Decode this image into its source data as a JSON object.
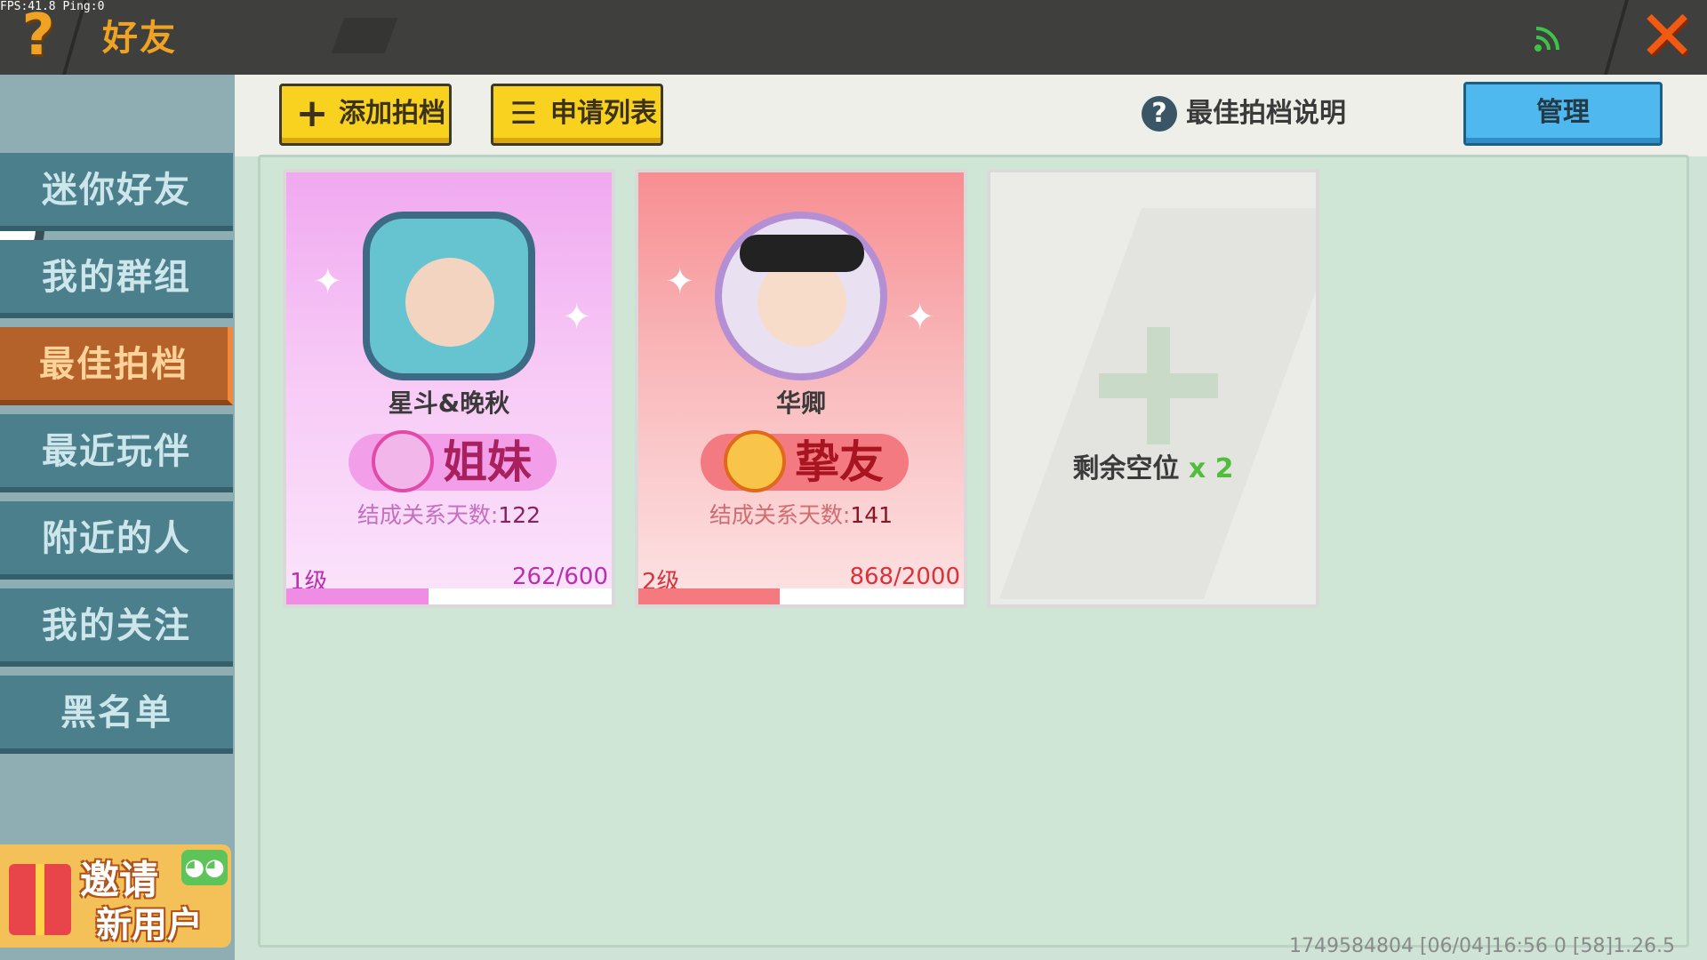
{
  "overlay": {
    "fps": "FPS:41.8 Ping:0"
  },
  "header": {
    "help_glyph": "?",
    "title": "好友",
    "close_glyph": "✕"
  },
  "sidebar": {
    "items": [
      {
        "label": "迷你好友",
        "active": false
      },
      {
        "label": "我的群组",
        "active": false
      },
      {
        "label": "最佳拍档",
        "active": true
      },
      {
        "label": "最近玩伴",
        "active": false
      },
      {
        "label": "附近的人",
        "active": false
      },
      {
        "label": "我的关注",
        "active": false
      },
      {
        "label": "黑名单",
        "active": false
      }
    ],
    "invite": {
      "line1": "邀请",
      "line2": "新用户"
    }
  },
  "toolbar": {
    "add_partner_label": "添加拍档",
    "add_partner_icon": "+",
    "request_list_label": "申请列表",
    "request_list_icon": "☰",
    "help_label": "最佳拍档说明",
    "help_icon": "?",
    "manage_label": "管理"
  },
  "partners": [
    {
      "name": "星斗&晚秋",
      "relation": "姐妹",
      "days_label": "结成关系天数:",
      "days": "122",
      "level": "1级",
      "exp": "262/600",
      "progress": 0.437,
      "theme_color": "#ee8de3"
    },
    {
      "name": "华卿",
      "relation": "挚友",
      "days_label": "结成关系天数:",
      "days": "141",
      "level": "2级",
      "exp": "868/2000",
      "progress": 0.434,
      "theme_color": "#f57a80"
    }
  ],
  "empty_slot": {
    "label": "剩余空位",
    "count": "x 2"
  },
  "footer": {
    "stamp": "1749584804    [06/04]16:56 0  [58]1.26.5"
  }
}
